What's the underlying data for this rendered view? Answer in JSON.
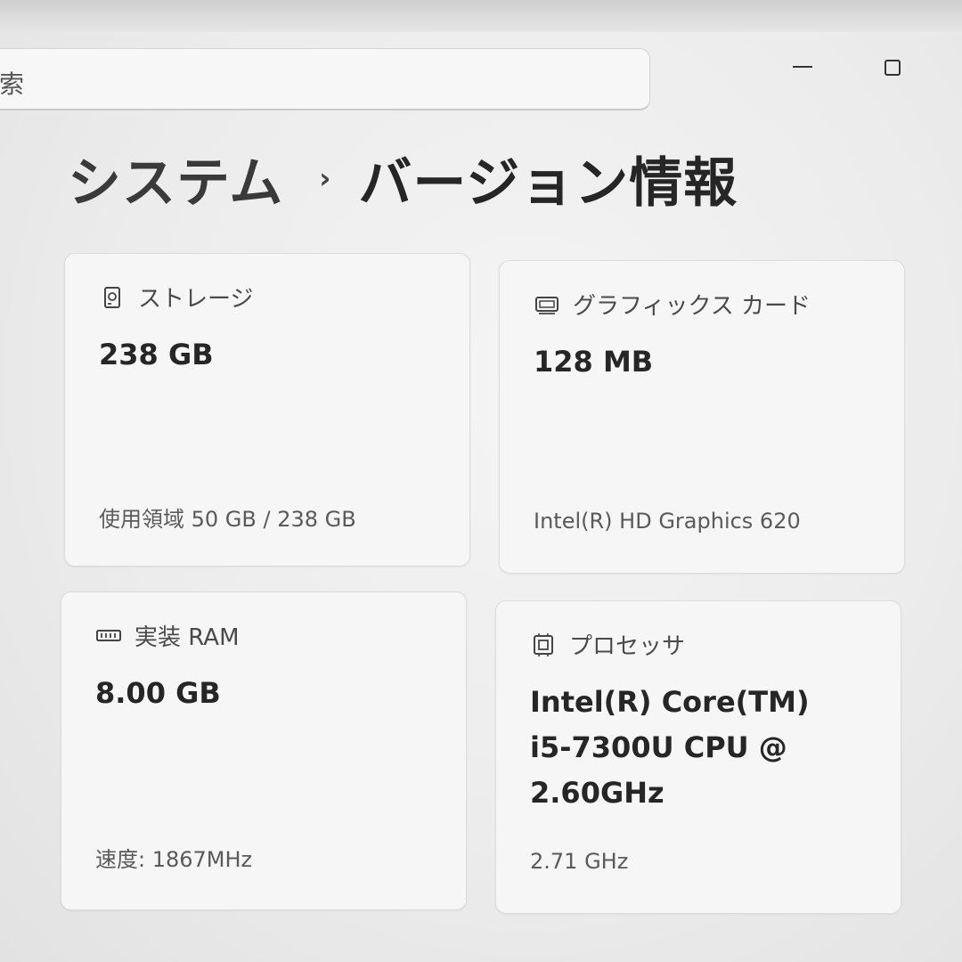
{
  "search": {
    "placeholder_fragment": "索"
  },
  "breadcrumb": {
    "parent": "システム",
    "separator": "›",
    "current": "バージョン情報"
  },
  "cards": {
    "storage": {
      "label": "ストレージ",
      "icon": "hard-drive-icon",
      "value": "238 GB",
      "detail": "使用領域 50 GB / 238 GB"
    },
    "gpu": {
      "label": "グラフィックス カード",
      "icon": "display-icon",
      "value": "128 MB",
      "detail": "Intel(R) HD Graphics 620"
    },
    "ram": {
      "label": "実装 RAM",
      "icon": "memory-icon",
      "value": "8.00 GB",
      "detail": "速度: 1867MHz"
    },
    "cpu": {
      "label": "プロセッサ",
      "icon": "processor-icon",
      "value_lines": [
        "Intel(R) Core(TM)",
        "i5-7300U CPU @",
        "2.60GHz"
      ],
      "detail": "2.71 GHz"
    }
  },
  "colors": {
    "background": "#ececec",
    "card": "#f6f6f6",
    "text": "#262626"
  }
}
